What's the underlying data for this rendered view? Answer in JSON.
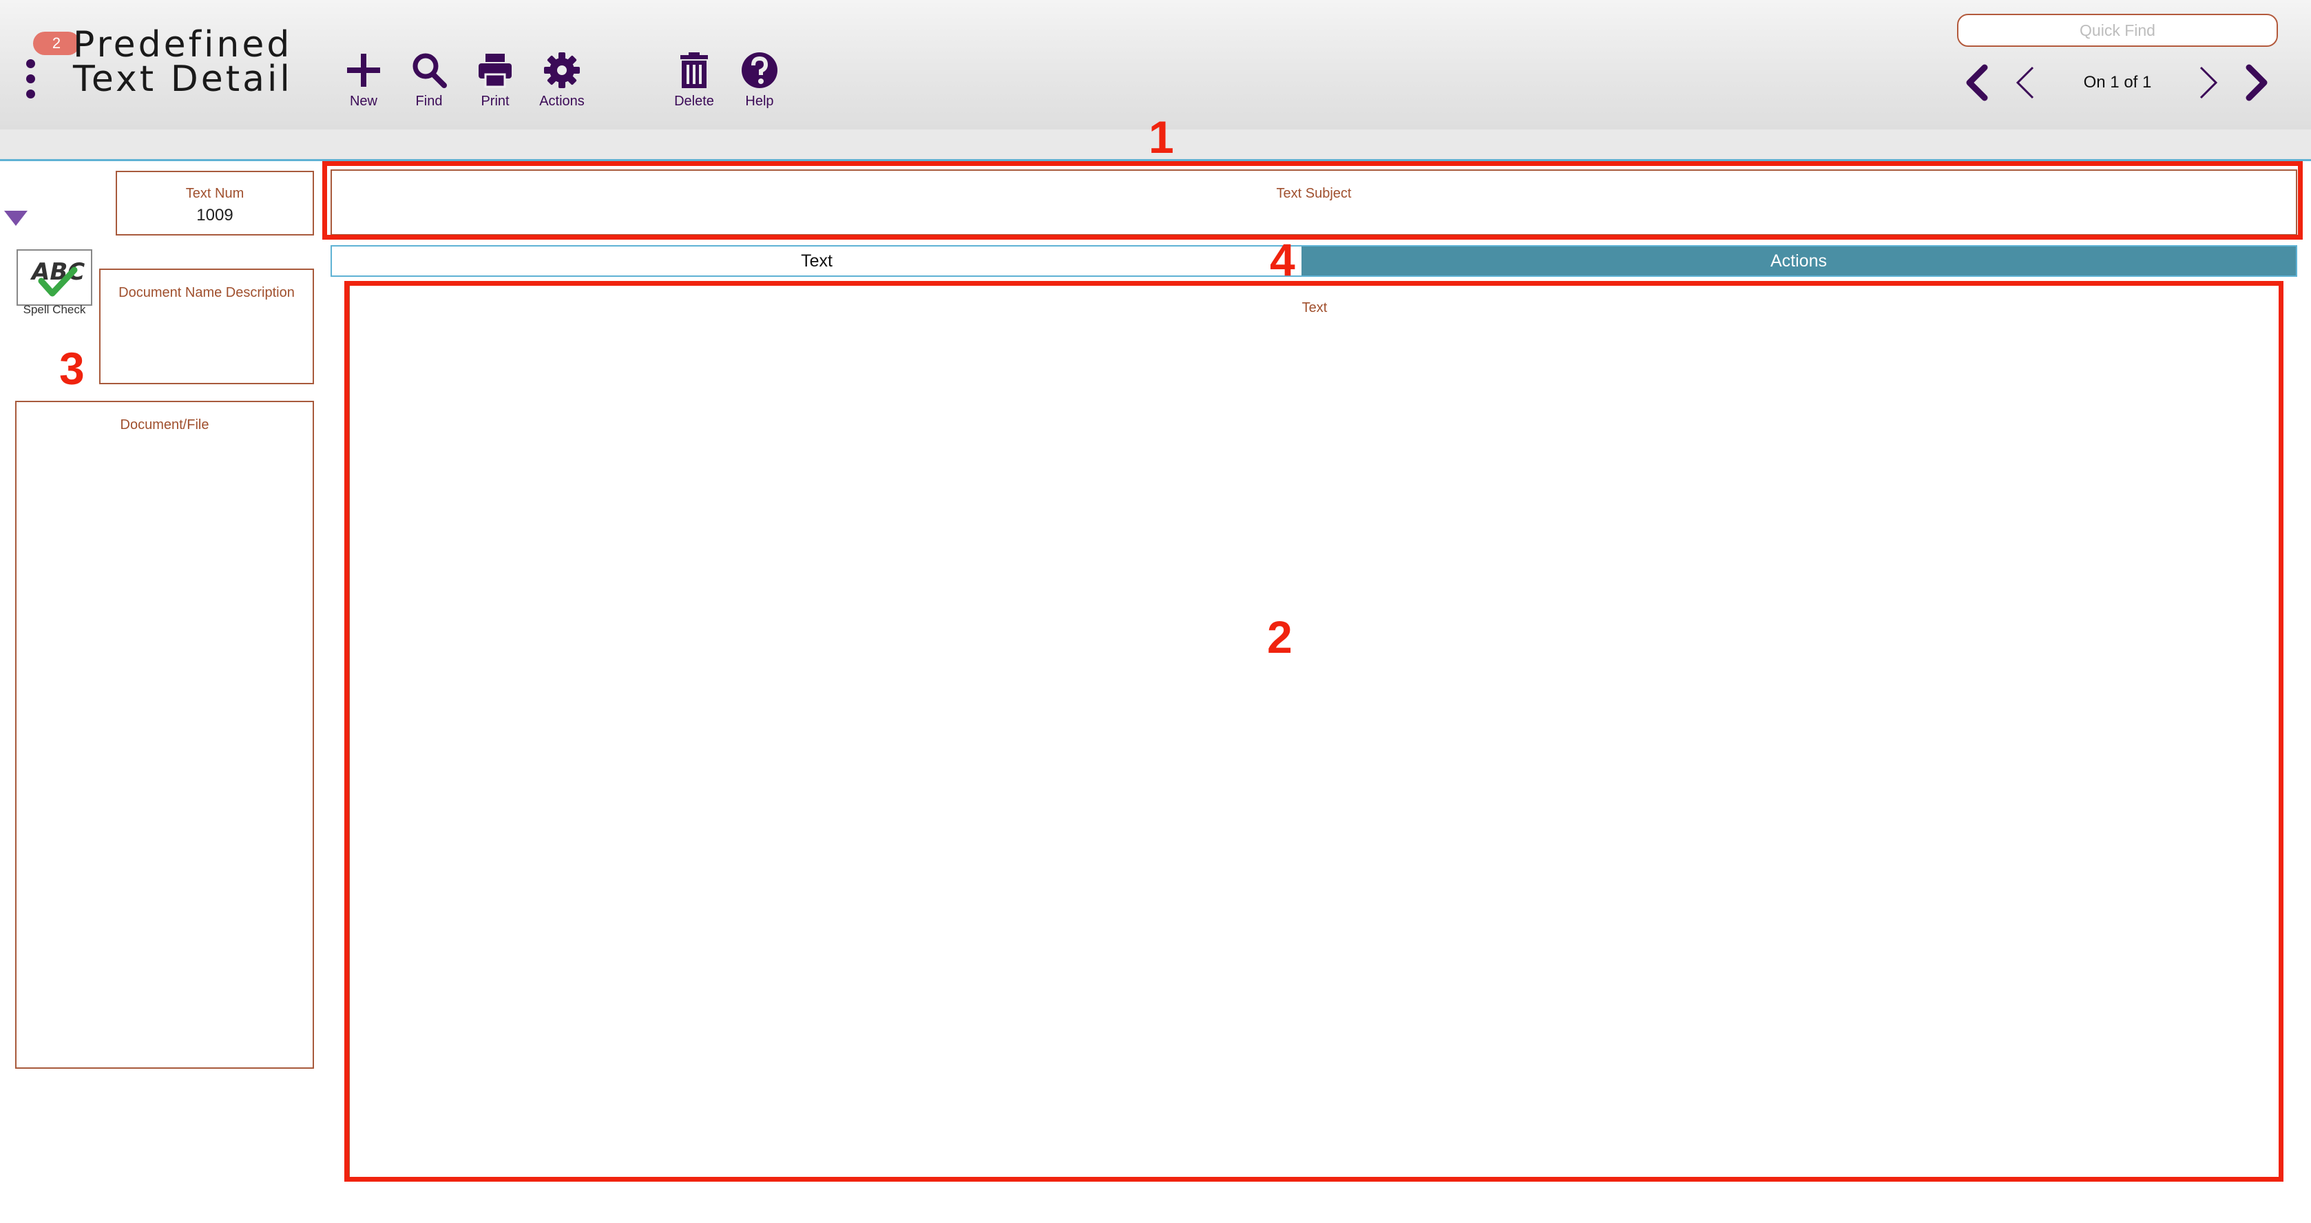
{
  "header": {
    "badge_count": "2",
    "title_line1": "Predefined",
    "title_line2": "Text Detail",
    "toolbar": {
      "new_label": "New",
      "find_label": "Find",
      "print_label": "Print",
      "actions_label": "Actions",
      "delete_label": "Delete",
      "help_label": "Help"
    },
    "quick_find_placeholder": "Quick Find",
    "pager_text": "On 1 of 1"
  },
  "form": {
    "text_num_label": "Text Num",
    "text_num_value": "1009",
    "doc_name_label": "Document Name Description",
    "doc_file_label": "Document/File",
    "spell_check_label": "Spell Check",
    "text_subject_label": "Text Subject",
    "text_area_label": "Text"
  },
  "tabs": [
    {
      "label": "Text",
      "active": true
    },
    {
      "label": "Actions",
      "active": false
    }
  ],
  "annotations": [
    "1",
    "2",
    "3",
    "4"
  ],
  "colors": {
    "brand_purple": "#3b0a57",
    "field_border": "#a85a3c",
    "tab_active_bg": "#4a8fa4",
    "annotation_red": "#f0230e",
    "badge": "#e4756a"
  },
  "icons": {
    "menu": "kebab-menu-icon",
    "new": "plus-icon",
    "find": "magnifier-icon",
    "print": "printer-icon",
    "actions": "gear-icon",
    "delete": "trash-icon",
    "help": "question-circle-icon",
    "spell": "spell-check-icon"
  }
}
